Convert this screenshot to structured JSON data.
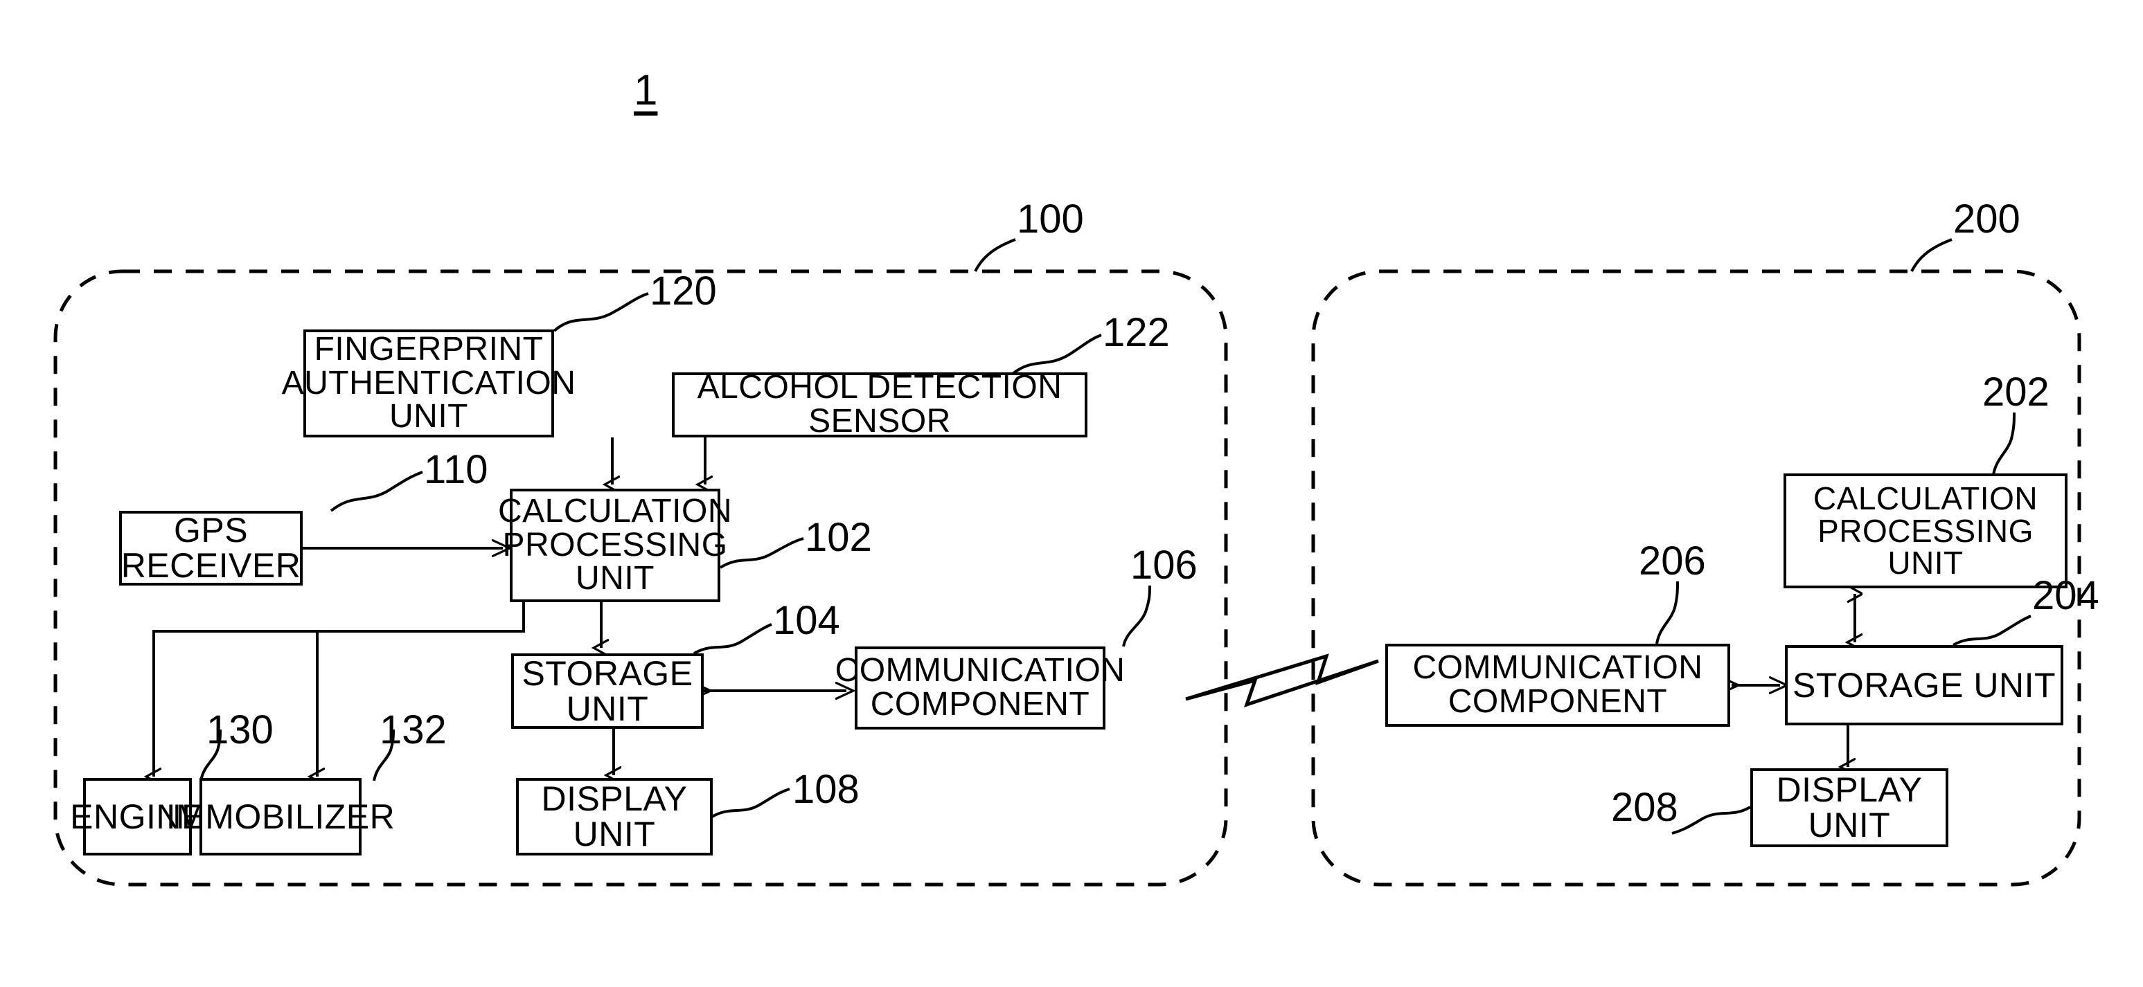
{
  "figure": {
    "number": "1",
    "domain": "patent-block-diagram"
  },
  "containers": [
    {
      "id": "vehicle-side",
      "ref": "100"
    },
    {
      "id": "server-side",
      "ref": "200"
    }
  ],
  "blocks": {
    "fingerprint_unit": {
      "label": "FINGERPRINT\nAUTHENTICATION\nUNIT",
      "ref": "120"
    },
    "alcohol_sensor": {
      "label": "ALCOHOL DETECTION\nSENSOR",
      "ref": "122"
    },
    "gps_receiver": {
      "label": "GPS RECEIVER",
      "ref": "110"
    },
    "calculation_unit_left": {
      "label": "CALCULATION\nPROCESSING\nUNIT",
      "ref": "102"
    },
    "storage_unit_left": {
      "label": "STORAGE UNIT",
      "ref": "104"
    },
    "communication_component_left": {
      "label": "COMMUNICATION\nCOMPONENT",
      "ref": "106"
    },
    "engine": {
      "label": "ENGINE",
      "ref": "130"
    },
    "immobilizer": {
      "label": "IMMOBILIZER",
      "ref": "132"
    },
    "display_unit_left": {
      "label": "DISPLAY UNIT",
      "ref": "108"
    },
    "calculation_unit_right": {
      "label": "CALCULATION\nPROCESSING\nUNIT",
      "ref": "202"
    },
    "storage_unit_right": {
      "label": "STORAGE UNIT",
      "ref": "204"
    },
    "communication_component_right": {
      "label": "COMMUNICATION\nCOMPONENT",
      "ref": "206"
    },
    "display_unit_right": {
      "label": "DISPLAY UNIT",
      "ref": "208"
    }
  },
  "icons": {
    "wireless_link": "lightning-bolt-icon"
  },
  "colors": {
    "line": "#000000",
    "background": "#ffffff"
  }
}
